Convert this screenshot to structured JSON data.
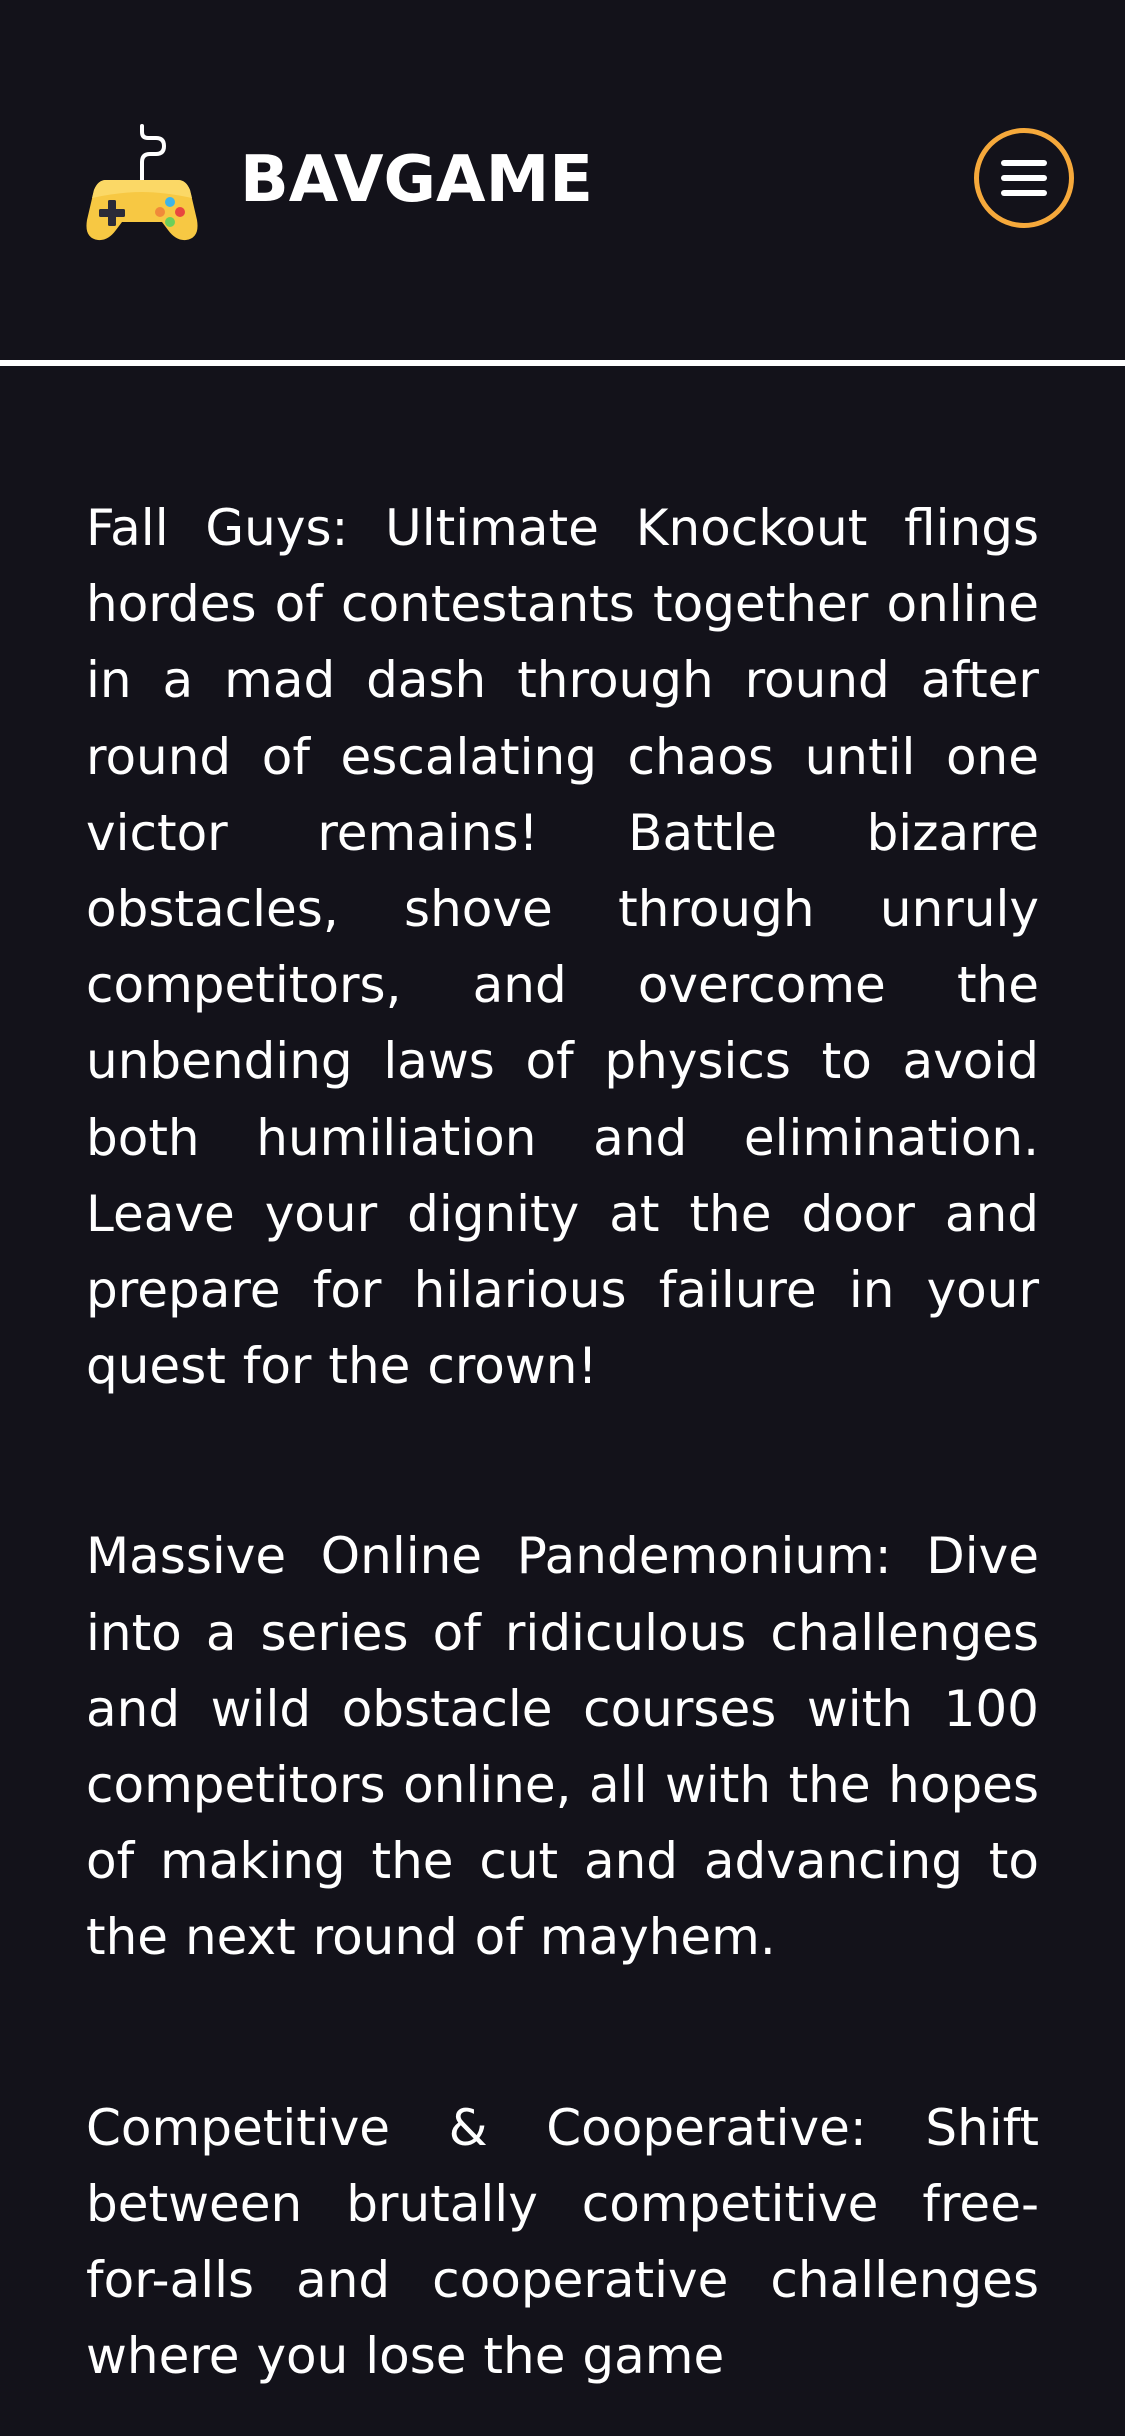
{
  "header": {
    "brand": "BAVGAME",
    "logo_icon": "gamepad-icon",
    "menu_icon": "hamburger-menu-icon"
  },
  "colors": {
    "background": "#13121a",
    "accent": "#f6a93b",
    "text": "#ffffff"
  },
  "content": {
    "paragraphs": [
      "Fall Guys: Ultimate Knockout flings hordes of contestants together online in a mad dash through round after round of escalating chaos until one victor remains! Battle bizarre obstacles, shove through unruly competitors, and overcome the unbending laws of physics to avoid both humiliation and elimination. Leave your dignity at the door and prepare for hilarious failure in your quest for the crown!",
      "Massive Online Pandemonium: Dive into a series of ridiculous challenges and wild obstacle courses with 100 competitors online, all with the hopes of making the cut and advancing to the next round of mayhem.",
      "Competitive & Cooperative: Shift between brutally competitive free-for-alls and cooperative challenges where you lose the game"
    ]
  }
}
